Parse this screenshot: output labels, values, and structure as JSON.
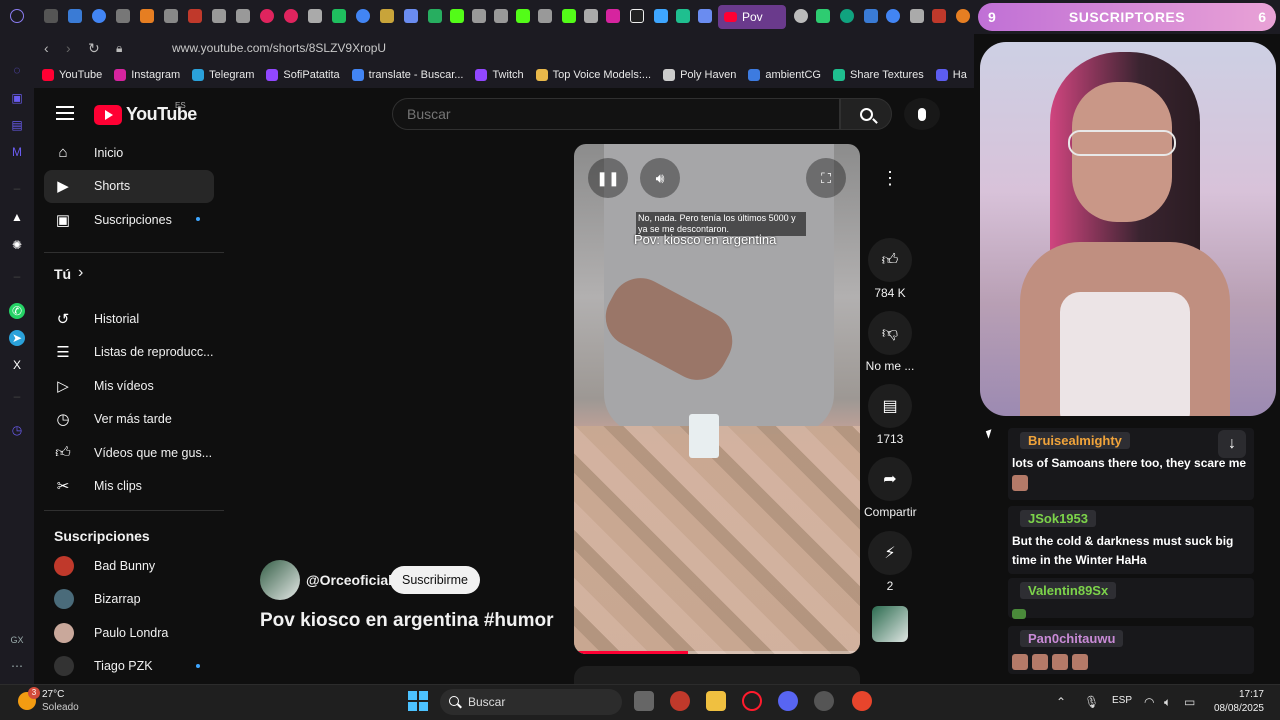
{
  "browser": {
    "active_tab_label": "Pov",
    "url": "www.youtube.com/shorts/8SLZV9XropU",
    "bookmarks": [
      {
        "label": "YouTube",
        "color": "#ff0033"
      },
      {
        "label": "Instagram",
        "color": "#d6249f"
      },
      {
        "label": "Telegram",
        "color": "#2aa1da"
      },
      {
        "label": "SofiPatatita",
        "color": "#9147ff"
      },
      {
        "label": "translate - Buscar...",
        "color": "#4285f4"
      },
      {
        "label": "Twitch",
        "color": "#9147ff"
      },
      {
        "label": "Top Voice Models:...",
        "color": "#e8b84a"
      },
      {
        "label": "Poly Haven",
        "color": "#cccccc"
      },
      {
        "label": "ambientCG",
        "color": "#3d7be0"
      },
      {
        "label": "Share Textures",
        "color": "#1fbf8f"
      },
      {
        "label": "Ha",
        "color": "#5d5df0"
      }
    ]
  },
  "youtube": {
    "logo_text": "YouTube",
    "region": "ES",
    "search_placeholder": "Buscar",
    "guide": {
      "main": [
        {
          "label": "Inicio",
          "icon": "home-icon"
        },
        {
          "label": "Shorts",
          "icon": "shorts-icon"
        },
        {
          "label": "Suscripciones",
          "icon": "subscriptions-icon"
        }
      ],
      "you_header": "Tú",
      "you_items": [
        {
          "label": "Historial",
          "icon": "history-icon"
        },
        {
          "label": "Listas de reproducc...",
          "icon": "playlists-icon"
        },
        {
          "label": "Mis vídeos",
          "icon": "my-videos-icon"
        },
        {
          "label": "Ver más tarde",
          "icon": "watch-later-icon"
        },
        {
          "label": "Vídeos que me gus...",
          "icon": "liked-videos-icon"
        },
        {
          "label": "Mis clips",
          "icon": "clips-icon"
        }
      ],
      "subs_header": "Suscripciones",
      "subs": [
        {
          "label": "Bad Bunny",
          "color": "#c0392b"
        },
        {
          "label": "Bizarrap",
          "color": "#4a6b7a"
        },
        {
          "label": "Paulo Londra",
          "color": "#c9a89b"
        },
        {
          "label": "Tiago PZK",
          "color": "#333333"
        }
      ]
    },
    "short": {
      "caption": "No, nada. Pero tenía los últimos 5000 y ya se me descontaron.",
      "overlay_title": "Pov: kiosco en argentina",
      "progress": 0.4,
      "channel": "@Orceoficial",
      "subscribe_label": "Suscribirme",
      "title": "Pov kiosco en argentina #humor",
      "actions": {
        "likes": "784 K",
        "dislike": "No me ...",
        "comments": "1713",
        "share": "Compartir",
        "remix": "2"
      }
    }
  },
  "stream_overlay": {
    "subs_left": "9",
    "subs_label": "SUSCRIPTORES",
    "subs_right": "6",
    "chat": [
      {
        "user": "Bruisealmighty",
        "color": "#f0a33a",
        "text": "lots of Samoans there too, they scare me"
      },
      {
        "user": "JSok1953",
        "color": "#7cd34a",
        "text": "But the cold & darkness must suck big time in the Winter HaHa"
      },
      {
        "user": "Valentin89Sx",
        "color": "#7cd34a",
        "text": ""
      },
      {
        "user": "Pan0chitauwu",
        "color": "#c98ad6",
        "text": ""
      }
    ]
  },
  "taskbar": {
    "weather_badge": "3",
    "temperature": "27°C",
    "condition": "Soleado",
    "search_label": "Buscar",
    "language": "ESP",
    "time": "17:17",
    "date": "08/08/2025"
  }
}
